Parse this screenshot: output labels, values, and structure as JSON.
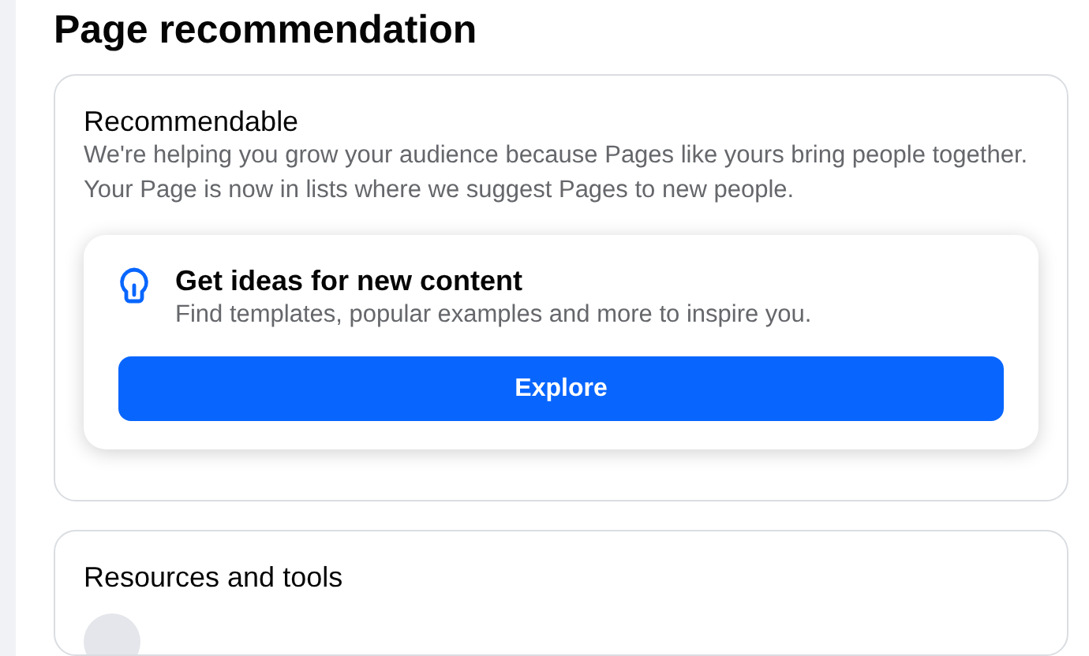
{
  "page_title": "Page recommendation",
  "recommendable": {
    "title": "Recommendable",
    "description": "We're helping you grow your audience because Pages like yours bring people together. Your Page is now in lists where we suggest Pages to new people.",
    "ideas_card": {
      "title": "Get ideas for new content",
      "subtitle": "Find templates, popular examples and more to inspire you.",
      "button": "Explore"
    }
  },
  "resources": {
    "title": "Resources and tools"
  }
}
